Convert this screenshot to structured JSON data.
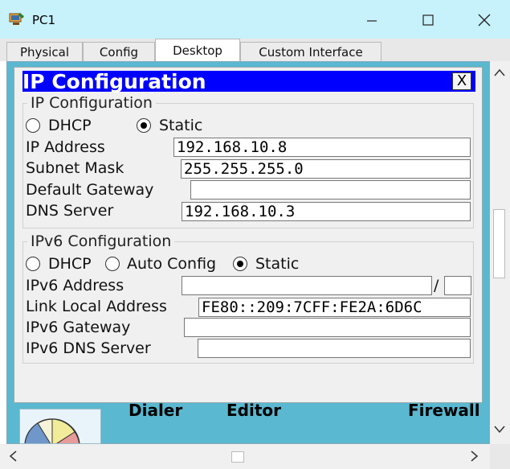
{
  "window": {
    "title": "PC1",
    "minimize_icon": "minimize-icon",
    "maximize_icon": "maximize-icon",
    "close_icon": "close-icon"
  },
  "tabs": [
    {
      "label": "Physical",
      "active": false
    },
    {
      "label": "Config",
      "active": false
    },
    {
      "label": "Desktop",
      "active": true
    },
    {
      "label": "Custom Interface",
      "active": false
    }
  ],
  "dialog": {
    "title": "IP Configuration",
    "close_label": "X",
    "ipv4": {
      "group_title": "IP Configuration",
      "dhcp_label": "DHCP",
      "static_label": "Static",
      "selected_mode": "Static",
      "ip_address_label": "IP Address",
      "ip_address": "192.168.10.8",
      "subnet_mask_label": "Subnet Mask",
      "subnet_mask": "255.255.255.0",
      "default_gateway_label": "Default Gateway",
      "default_gateway": "",
      "dns_server_label": "DNS Server",
      "dns_server": "192.168.10.3"
    },
    "ipv6": {
      "group_title": "IPv6 Configuration",
      "dhcp_label": "DHCP",
      "auto_config_label": "Auto Config",
      "static_label": "Static",
      "selected_mode": "Static",
      "address_label": "IPv6 Address",
      "address": "",
      "prefix_separator": "/",
      "prefix_length": "",
      "link_local_label": "Link Local Address",
      "link_local": "FE80::209:7CFF:FE2A:6D6C",
      "gateway_label": "IPv6 Gateway",
      "gateway": "",
      "dns_server_label": "IPv6 DNS Server",
      "dns_server": ""
    }
  },
  "background_apps": {
    "dialer": "Dialer",
    "editor": "Editor",
    "firewall": "Firewall"
  },
  "colors": {
    "titlebar": "#c7f1fb",
    "desktop_bg": "#5ab8d0",
    "dialog_header": "#0000ff"
  }
}
